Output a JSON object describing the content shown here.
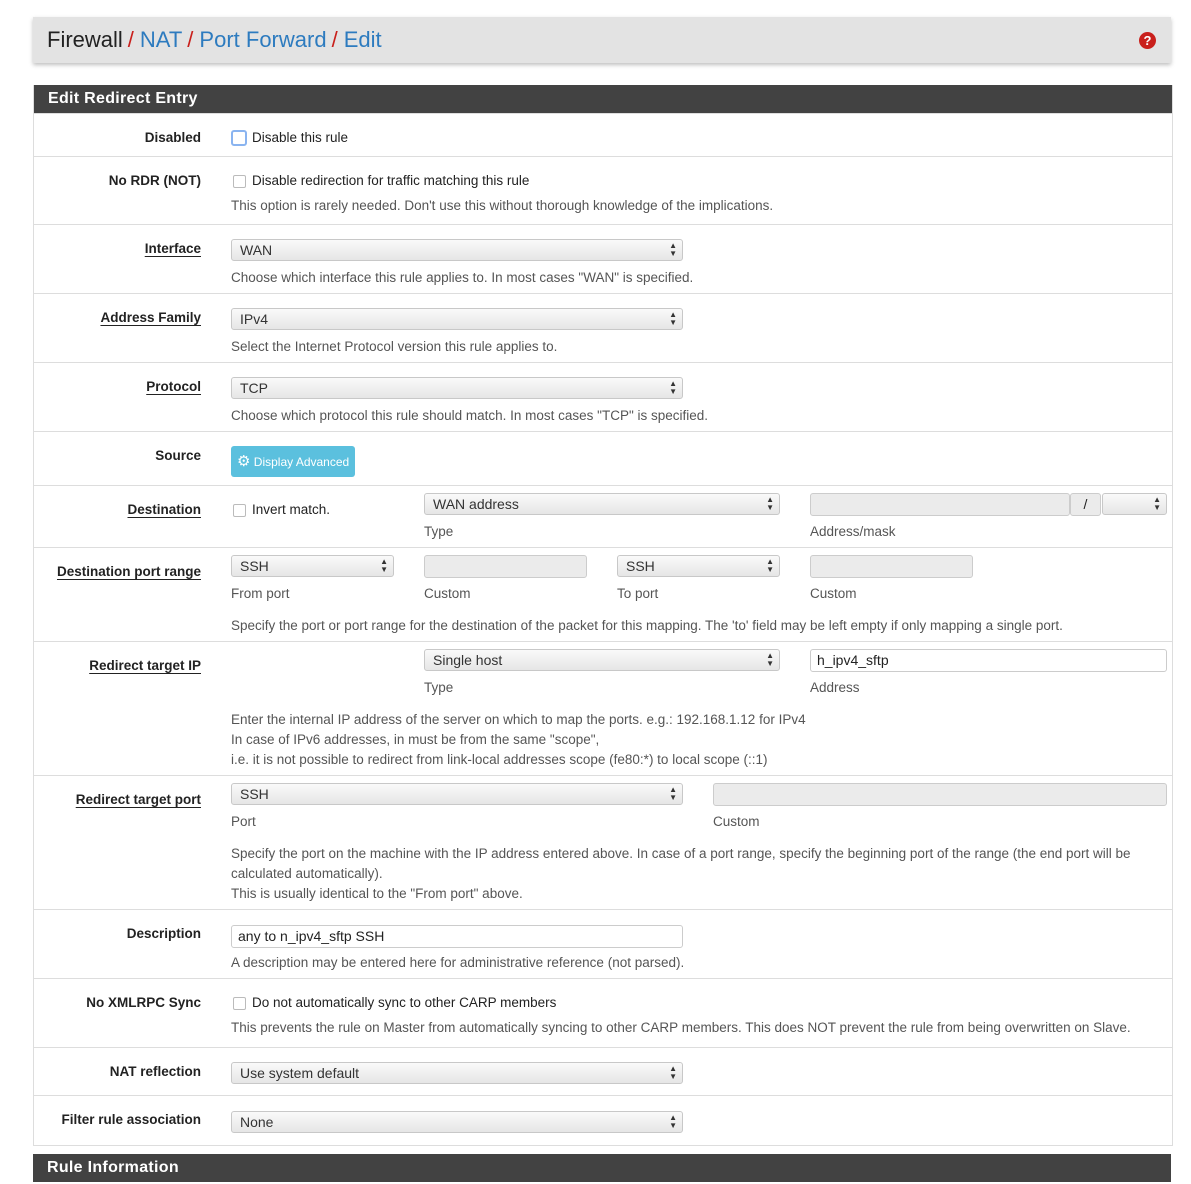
{
  "breadcrumb": [
    "Firewall",
    "NAT",
    "Port Forward",
    "Edit"
  ],
  "help_icon": "question-circle-icon",
  "panel_title": "Edit Redirect Entry",
  "rows": {
    "disabled": {
      "label": "Disabled",
      "checkbox": "Disable this rule",
      "checked": false
    },
    "nordr": {
      "label": "No RDR (NOT)",
      "checkbox": "Disable redirection for traffic matching this rule",
      "checked": false,
      "help": "This option is rarely needed. Don't use this without thorough knowledge of the implications."
    },
    "interface": {
      "label": "Interface",
      "value": "WAN",
      "help": "Choose which interface this rule applies to. In most cases \"WAN\" is specified."
    },
    "family": {
      "label": "Address Family",
      "value": "IPv4",
      "help": "Select the Internet Protocol version this rule applies to."
    },
    "protocol": {
      "label": "Protocol",
      "value": "TCP",
      "help": "Choose which protocol this rule should match. In most cases \"TCP\" is specified."
    },
    "source": {
      "label": "Source",
      "button": "Display Advanced",
      "icon": "gear-icon"
    },
    "destination": {
      "label": "Destination",
      "invert": "Invert match.",
      "type_value": "WAN address",
      "type_label": "Type",
      "address": "",
      "slash": "/",
      "mask": "",
      "address_label": "Address/mask"
    },
    "dport": {
      "label": "Destination port range",
      "from": "SSH",
      "from_label": "From port",
      "from_custom": "",
      "from_custom_label": "Custom",
      "to": "SSH",
      "to_label": "To port",
      "to_custom": "",
      "to_custom_label": "Custom",
      "help": "Specify the port or port range for the destination of the packet for this mapping. The 'to' field may be left empty if only mapping a single port."
    },
    "rip": {
      "label": "Redirect target IP",
      "type_value": "Single host",
      "type_label": "Type",
      "address": "h_ipv4_sftp",
      "address_label": "Address",
      "help1": "Enter the internal IP address of the server on which to map the ports. e.g.: 192.168.1.12 for IPv4",
      "help2": "In case of IPv6 addresses, in must be from the same \"scope\",",
      "help3": "i.e. it is not possible to redirect from link-local addresses scope (fe80:*) to local scope (::1)"
    },
    "rport": {
      "label": "Redirect target port",
      "value": "SSH",
      "port_label": "Port",
      "custom": "",
      "custom_label": "Custom",
      "help1": "Specify the port on the machine with the IP address entered above. In case of a port range, specify the beginning port of the range (the end port will be",
      "help2": "calculated automatically).",
      "help3": "This is usually identical to the \"From port\" above."
    },
    "description": {
      "label": "Description",
      "value": "any to n_ipv4_sftp SSH",
      "help": "A description may be entered here for administrative reference (not parsed)."
    },
    "xmlrpc": {
      "label": "No XMLRPC Sync",
      "checkbox": "Do not automatically sync to other CARP members",
      "checked": false,
      "help": "This prevents the rule on Master from automatically syncing to other CARP members. This does NOT prevent the rule from being overwritten on Slave."
    },
    "natrefl": {
      "label": "NAT reflection",
      "value": "Use system default"
    },
    "filter": {
      "label": "Filter rule association",
      "value": "None"
    }
  },
  "panel2_title": "Rule Information"
}
